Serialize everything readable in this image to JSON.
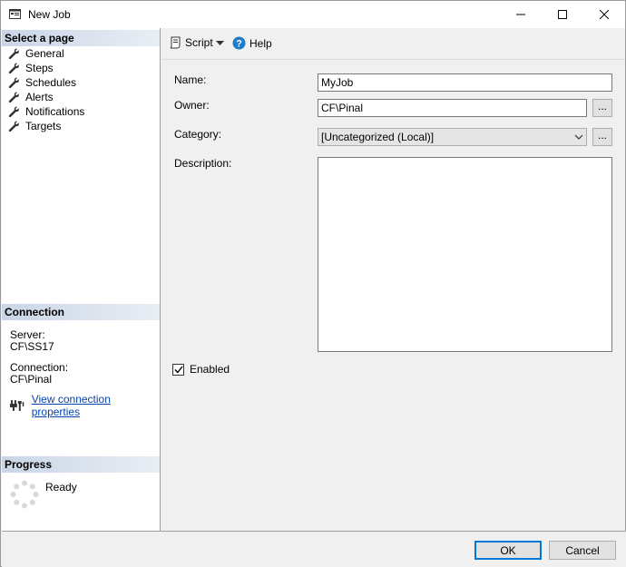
{
  "window": {
    "title": "New Job",
    "controls": {
      "minimize": "minimize",
      "maximize": "maximize",
      "close": "close"
    }
  },
  "left_pane": {
    "select_page_header": "Select a page",
    "pages": [
      {
        "label": "General",
        "icon": "wrench-icon"
      },
      {
        "label": "Steps",
        "icon": "wrench-icon"
      },
      {
        "label": "Schedules",
        "icon": "wrench-icon"
      },
      {
        "label": "Alerts",
        "icon": "wrench-icon"
      },
      {
        "label": "Notifications",
        "icon": "wrench-icon"
      },
      {
        "label": "Targets",
        "icon": "wrench-icon"
      }
    ],
    "connection_header": "Connection",
    "server_label": "Server:",
    "server_value": "CF\\SS17",
    "connection_label": "Connection:",
    "connection_value": "CF\\Pinal",
    "view_connection_link": "View connection properties",
    "progress_header": "Progress",
    "progress_status": "Ready"
  },
  "toolbar": {
    "script_label": "Script",
    "help_label": "Help"
  },
  "form": {
    "name_label": "Name:",
    "name_value": "MyJob",
    "owner_label": "Owner:",
    "owner_value": "CF\\Pinal",
    "owner_browse": "...",
    "category_label": "Category:",
    "category_value": "[Uncategorized (Local)]",
    "category_browse": "...",
    "description_label": "Description:",
    "enabled_label": "Enabled",
    "enabled_checked": true
  },
  "buttons": {
    "ok": "OK",
    "cancel": "Cancel"
  },
  "colors": {
    "section_header": "#c9d5e6",
    "link": "#0645ad",
    "help_icon": "#1e7bc8",
    "default_button_border": "#0078d7"
  }
}
